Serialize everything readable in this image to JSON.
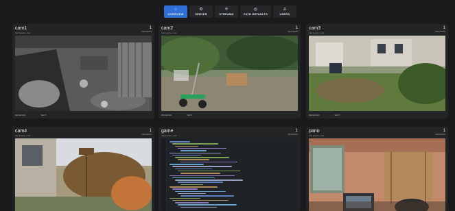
{
  "nav": [
    {
      "label": "OVERVIEW",
      "icon": "home-icon",
      "active": true
    },
    {
      "label": "SERVER",
      "icon": "gear-icon",
      "active": false
    },
    {
      "label": "STREAMS",
      "icon": "grid-icon",
      "active": false
    },
    {
      "label": "PATH DEFAULTS",
      "icon": "settings-icon",
      "active": false
    },
    {
      "label": "USERS",
      "icon": "user-icon",
      "active": false
    }
  ],
  "cards": [
    {
      "name": "cam1",
      "subtitle": "rtsp source • raw",
      "readers": "1",
      "readers_label": "READERS",
      "received": "RECEIVED",
      "sent": "SENT"
    },
    {
      "name": "cam2",
      "subtitle": "rtsp source • raw",
      "readers": "1",
      "readers_label": "READERS",
      "received": "RECEIVED",
      "sent": "SENT"
    },
    {
      "name": "cam3",
      "subtitle": "rtsp source • raw",
      "readers": "1",
      "readers_label": "READERS",
      "received": "RECEIVED",
      "sent": "SENT"
    },
    {
      "name": "cam4",
      "subtitle": "rtsp source • raw",
      "readers": "1",
      "readers_label": "READERS"
    },
    {
      "name": "game",
      "subtitle": "rtsp source • raw",
      "readers": "1",
      "readers_label": "READERS"
    },
    {
      "name": "pano",
      "subtitle": "rtsp source • raw",
      "readers": "1",
      "readers_label": "READERS"
    }
  ],
  "colors": {
    "accent": "#2f6fd6",
    "background": "#1a1a1c",
    "card": "#232426"
  }
}
